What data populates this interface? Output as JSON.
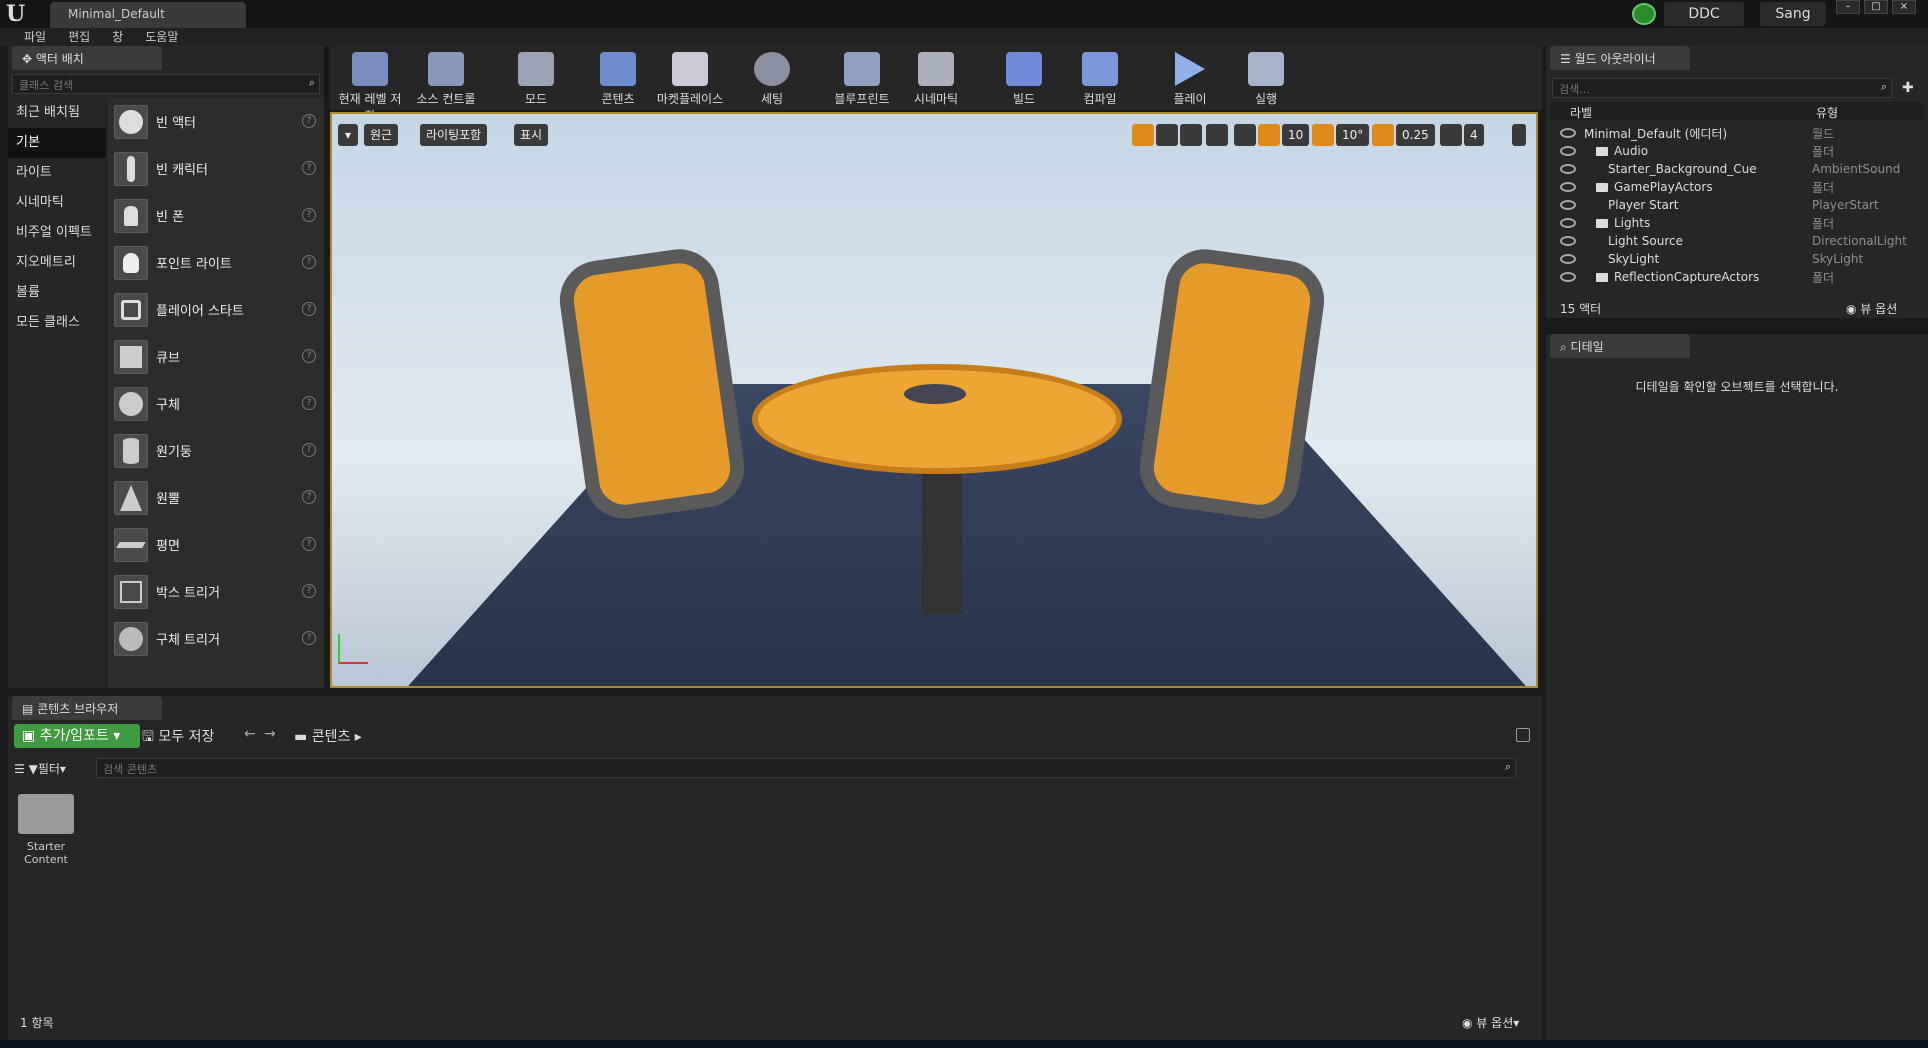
{
  "window": {
    "title": "Minimal_Default",
    "ddc": "DDC",
    "user": "Sang"
  },
  "menu": [
    "파일",
    "편집",
    "창",
    "도움말"
  ],
  "place": {
    "tab": "액터 배치",
    "search_placeholder": "클래스 검색",
    "categories": [
      "최근 배치됨",
      "기본",
      "라이트",
      "시네마틱",
      "비주얼 이펙트",
      "지오메트리",
      "볼륨",
      "모든 클래스"
    ],
    "selected_category": "기본",
    "items": [
      "빈 액터",
      "빈 캐릭터",
      "빈 폰",
      "포인트 라이트",
      "플레이어 스타트",
      "큐브",
      "구체",
      "원기둥",
      "원뿔",
      "평면",
      "박스 트리거",
      "구체 트리거"
    ]
  },
  "toolbar": [
    "현재 레벨 저장",
    "소스 컨트롤",
    "모드",
    "콘텐츠",
    "마켓플레이스",
    "세팅",
    "블루프린트",
    "시네마틱",
    "빌드",
    "컴파일",
    "플레이",
    "실행"
  ],
  "viewport": {
    "perspective": "원근",
    "lighting": "라이팅포함",
    "show": "표시",
    "grid": "10",
    "rotation": "10°",
    "scale": "0.25",
    "camera_speed": "4"
  },
  "outliner": {
    "tab": "월드 아웃라이너",
    "search_placeholder": "검색...",
    "col_label": "라벨",
    "col_type": "유형",
    "rows": [
      {
        "label": "Minimal_Default (에디터)",
        "type": "월드",
        "indent": 0,
        "folder": false
      },
      {
        "label": "Audio",
        "type": "폴더",
        "indent": 1,
        "folder": true
      },
      {
        "label": "Starter_Background_Cue",
        "type": "AmbientSound",
        "indent": 2,
        "folder": false
      },
      {
        "label": "GamePlayActors",
        "type": "폴더",
        "indent": 1,
        "folder": true
      },
      {
        "label": "Player Start",
        "type": "PlayerStart",
        "indent": 2,
        "folder": false
      },
      {
        "label": "Lights",
        "type": "폴더",
        "indent": 1,
        "folder": true
      },
      {
        "label": "Light Source",
        "type": "DirectionalLight",
        "indent": 2,
        "folder": false
      },
      {
        "label": "SkyLight",
        "type": "SkyLight",
        "indent": 2,
        "folder": false
      },
      {
        "label": "ReflectionCaptureActors",
        "type": "폴더",
        "indent": 1,
        "folder": true
      }
    ],
    "count": "15 액터",
    "view_options": "뷰 옵션"
  },
  "details": {
    "tab": "디테일",
    "message": "디테일을 확인할 오브젝트를 선택합니다."
  },
  "content": {
    "tab": "콘텐츠 브라우저",
    "add_import": "추가/임포트",
    "save_all": "모두 저장",
    "path": "콘텐츠",
    "filter": "필터",
    "search_placeholder": "검색 콘텐츠",
    "folder_name": "Starter Content",
    "item_count": "1 항목",
    "view_options": "뷰 옵션"
  }
}
